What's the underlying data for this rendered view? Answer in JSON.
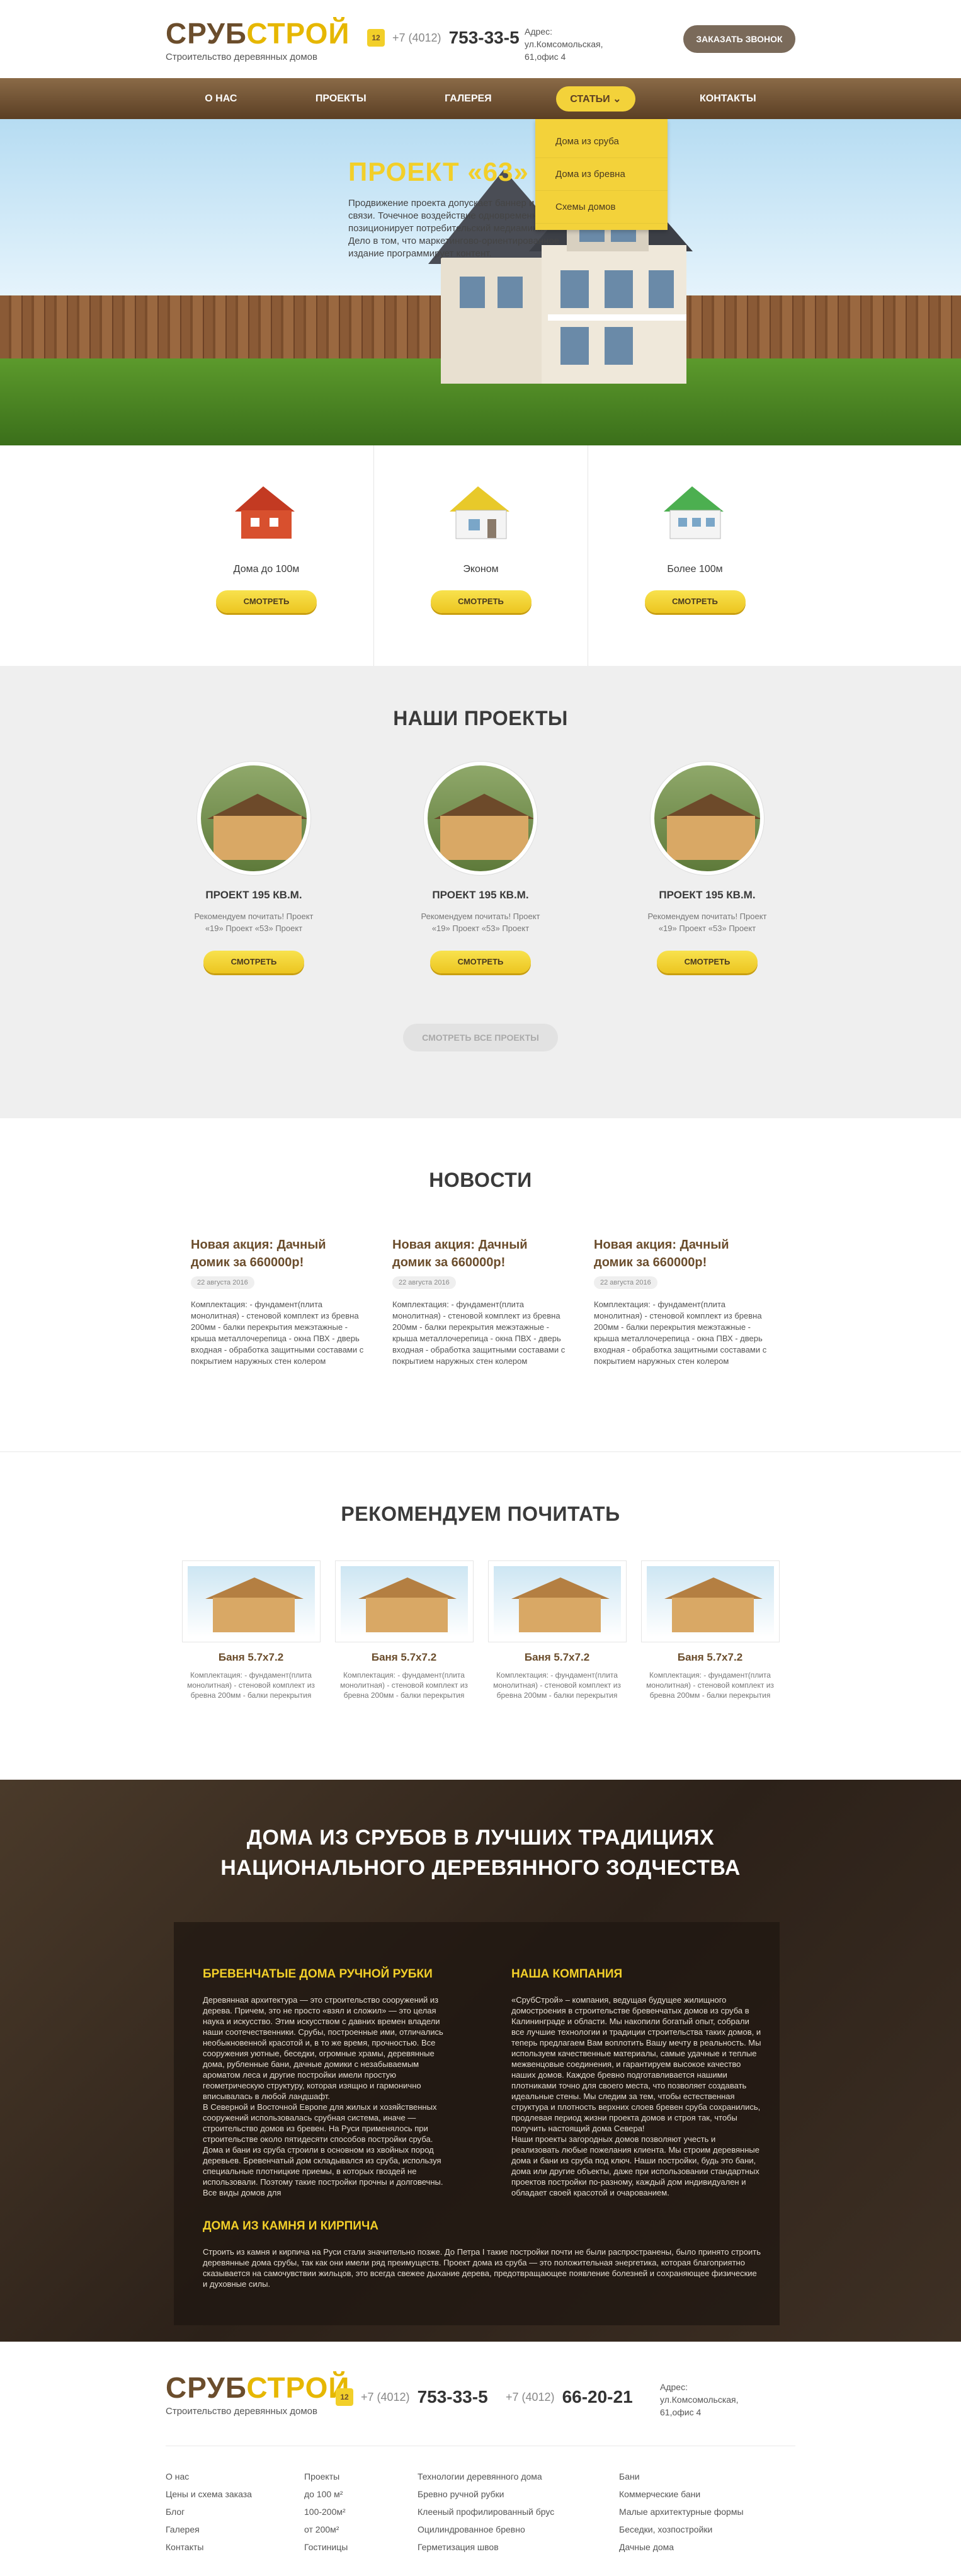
{
  "header": {
    "logo_part1": "СРУБ",
    "logo_part2": "СТРОЙ",
    "tagline": "Строительство деревянных домов",
    "phone_icon": "12",
    "phone_code": "+7 (4012)",
    "phone_number": "753-33-5",
    "address": "Адрес: ул.Комсомольская, 61,офис 4",
    "call_button": "ЗАКАЗАТЬ ЗВОНОК"
  },
  "nav": {
    "items": [
      "О НАС",
      "ПРОЕКТЫ",
      "ГАЛЕРЕЯ",
      "СТАТЬИ ⌄",
      "КОНТАКТЫ"
    ],
    "dropdown": [
      "Дома из сруба",
      "Дома из бревна",
      "Схемы домов"
    ]
  },
  "hero": {
    "title_a": "ПРОЕКТ ",
    "title_b": "«63»",
    "desc": "Продвижение проекта допускает баннер и связи. Точечное воздействие одновременно позиционирует потребительский медиамикс. Дело в том, что маркетингово-ориентированное издание программирует контент."
  },
  "categories": [
    {
      "label": "Дома до 100м",
      "button": "СМОТРЕТЬ",
      "color": "#d44a2a"
    },
    {
      "label": "Эконом",
      "button": "СМОТРЕТЬ",
      "color": "#e9d43a"
    },
    {
      "label": "Более 100м",
      "button": "СМОТРЕТЬ",
      "color": "#4fbf5a"
    }
  ],
  "projects": {
    "heading": "НАШИ ПРОЕКТЫ",
    "items": [
      {
        "title": "ПРОЕКТ 195 КВ.М.",
        "desc": "Рекомендуем почитать! Проект «19» Проект «53» Проект",
        "button": "СМОТРЕТЬ"
      },
      {
        "title": "ПРОЕКТ 195 КВ.М.",
        "desc": "Рекомендуем почитать! Проект «19» Проект «53» Проект",
        "button": "СМОТРЕТЬ"
      },
      {
        "title": "ПРОЕКТ 195 КВ.М.",
        "desc": "Рекомендуем почитать! Проект «19» Проект «53» Проект",
        "button": "СМОТРЕТЬ"
      }
    ],
    "all_button": "СМОТРЕТЬ ВСЕ ПРОЕКТЫ"
  },
  "news": {
    "heading": "НОВОСТИ",
    "items": [
      {
        "title": "Новая акция: Дачный домик за 660000р!",
        "date": "22 августа 2016",
        "text": "Комплектация: - фундамент(плита монолитная) - стеновой комплект из бревна 200мм - балки перекрытия межэтажные - крыша металлочерепица - окна ПВХ - дверь входная - обработка защитными составами с покрытием наружных стен колером"
      },
      {
        "title": "Новая акция: Дачный домик за 660000р!",
        "date": "22 августа 2016",
        "text": "Комплектация: - фундамент(плита монолитная) - стеновой комплект из бревна 200мм - балки перекрытия межэтажные - крыша металлочерепица - окна ПВХ - дверь входная - обработка защитными составами с покрытием наружных стен колером"
      },
      {
        "title": "Новая акция: Дачный домик за 660000р!",
        "date": "22 августа 2016",
        "text": "Комплектация: - фундамент(плита монолитная) - стеновой комплект из бревна 200мм - балки перекрытия межэтажные - крыша металлочерепица - окна ПВХ - дверь входная - обработка защитными составами с покрытием наружных стен колером"
      }
    ]
  },
  "recommend": {
    "heading": "РЕКОМЕНДУЕМ ПОЧИТАТЬ",
    "items": [
      {
        "title": "Баня 5.7x7.2",
        "text": "Комплектация: - фундамент(плита монолитная) - стеновой комплект из бревна 200мм - балки перекрытия"
      },
      {
        "title": "Баня 5.7x7.2",
        "text": "Комплектация: - фундамент(плита монолитная) - стеновой комплект из бревна 200мм - балки перекрытия"
      },
      {
        "title": "Баня 5.7x7.2",
        "text": "Комплектация: - фундамент(плита монолитная) - стеновой комплект из бревна 200мм - балки перекрытия"
      },
      {
        "title": "Баня 5.7x7.2",
        "text": "Комплектация: - фундамент(плита монолитная) - стеновой комплект из бревна 200мм - балки перекрытия"
      }
    ]
  },
  "about": {
    "heading_line1": "ДОМА ИЗ СРУБОВ В ЛУЧШИХ ТРАДИЦИЯХ",
    "heading_line2": "НАЦИОНАЛЬНОГО ДЕРЕВЯННОГО ЗОДЧЕСТВА",
    "col1_title": "БРЕВЕНЧАТЫЕ ДОМА РУЧНОЙ РУБКИ",
    "col1_text": "Деревянная архитектура — это строительство сооружений из дерева. Причем, это не просто «взял и сложил» — это целая наука и искусство. Этим искусством с давних времен владели наши соотечественники. Срубы, построенные ими, отличались необыкновенной красотой и, в то же время, прочностью. Все сооружения уютные, беседки, огромные храмы, деревянные дома, рубленные бани, дачные домики с незабываемым ароматом леса и другие постройки имели простую геометрическую структуру, которая изящно и гармонично вписывалась в любой ландшафт.\nВ Северной и Восточной Европе для жилых и хозяйственных сооружений использовалась срубная система, иначе — строительство домов из бревен. На Руси применялось при строительстве около пятидесяти способов постройки сруба. Дома и бани из сруба строили в основном из хвойных пород деревьев. Бревенчатый дом складывался из сруба, используя специальные плотницкие приемы, в которых гвоздей не использовали. Поэтому такие постройки прочны и долговечны. Все виды домов для",
    "col2_title": "НАША КОМПАНИЯ",
    "col2_text": "«СрубСтрой» – компания, ведущая будущее жилищного домостроения в строительстве бревенчатых домов из сруба в Калининграде и области. Мы накопили богатый опыт, собрали все лучшие технологии и традиции строительства таких домов, и теперь предлагаем Вам воплотить Вашу мечту в реальность. Мы используем качественные материалы, самые удачные и теплые межвенцовые соединения, и гарантируем высокое качество наших домов. Каждое бревно подготавливается нашими плотниками точно для своего места, что позволяет создавать идеальные стены. Мы следим за тем, чтобы естественная структура и плотность верхних слоев бревен сруба сохранились, продлевая период жизни проекта домов и строя так, чтобы получить настоящий дома Севера!\nНаши проекты загородных домов позволяют учесть и реализовать любые пожелания клиента. Мы строим деревянные дома и бани из сруба под ключ. Наши постройки, будь это бани, дома или другие объекты, даже при использовании стандартных проектов постройки по-разному, каждый дом индивидуален и обладает своей красотой и очарованием.",
    "col3_title": "ДОМА ИЗ КАМНЯ И КИРПИЧА",
    "col3_text": "Строить из камня и кирпича на Руси стали значительно позже. До Петра I такие постройки почти не были распространены, было принято строить деревянные дома срубы, так как они имели ряд преимуществ. Проект дома из сруба — это положительная энергетика, которая благоприятно сказывается на самочувствии жильцов, это всегда свежее дыхание дерева, предотвращающее появление болезней и сохраняющее физические и духовные силы."
  },
  "footer": {
    "logo_part1": "СРУБ",
    "logo_part2": "СТРОЙ",
    "tagline": "Строительство деревянных домов",
    "phone_icon": "12",
    "phone_code": "+7 (4012)",
    "phone1": "753-33-5",
    "phone_code2": "+7 (4012)",
    "phone2": "66-20-21",
    "address": "Адрес: ул.Комсомольская, 61,офис 4",
    "col1": [
      "О нас",
      "Цены и схема заказа",
      "Блог",
      "Галерея",
      "Контакты"
    ],
    "col2": [
      "Проекты",
      "до 100 м²",
      "100-200м²",
      "от 200м²",
      "Гостиницы"
    ],
    "col3": [
      "Технологии деревянного дома",
      "Бревно ручной рубки",
      "Клееный профилированный брус",
      "Оцилиндрованное бревно",
      "Герметизация швов"
    ],
    "col4": [
      "Бани",
      "Коммерческие бани",
      "Малые архитектурные формы",
      "Беседки, хозпостройки",
      "Дачные дома"
    ]
  }
}
